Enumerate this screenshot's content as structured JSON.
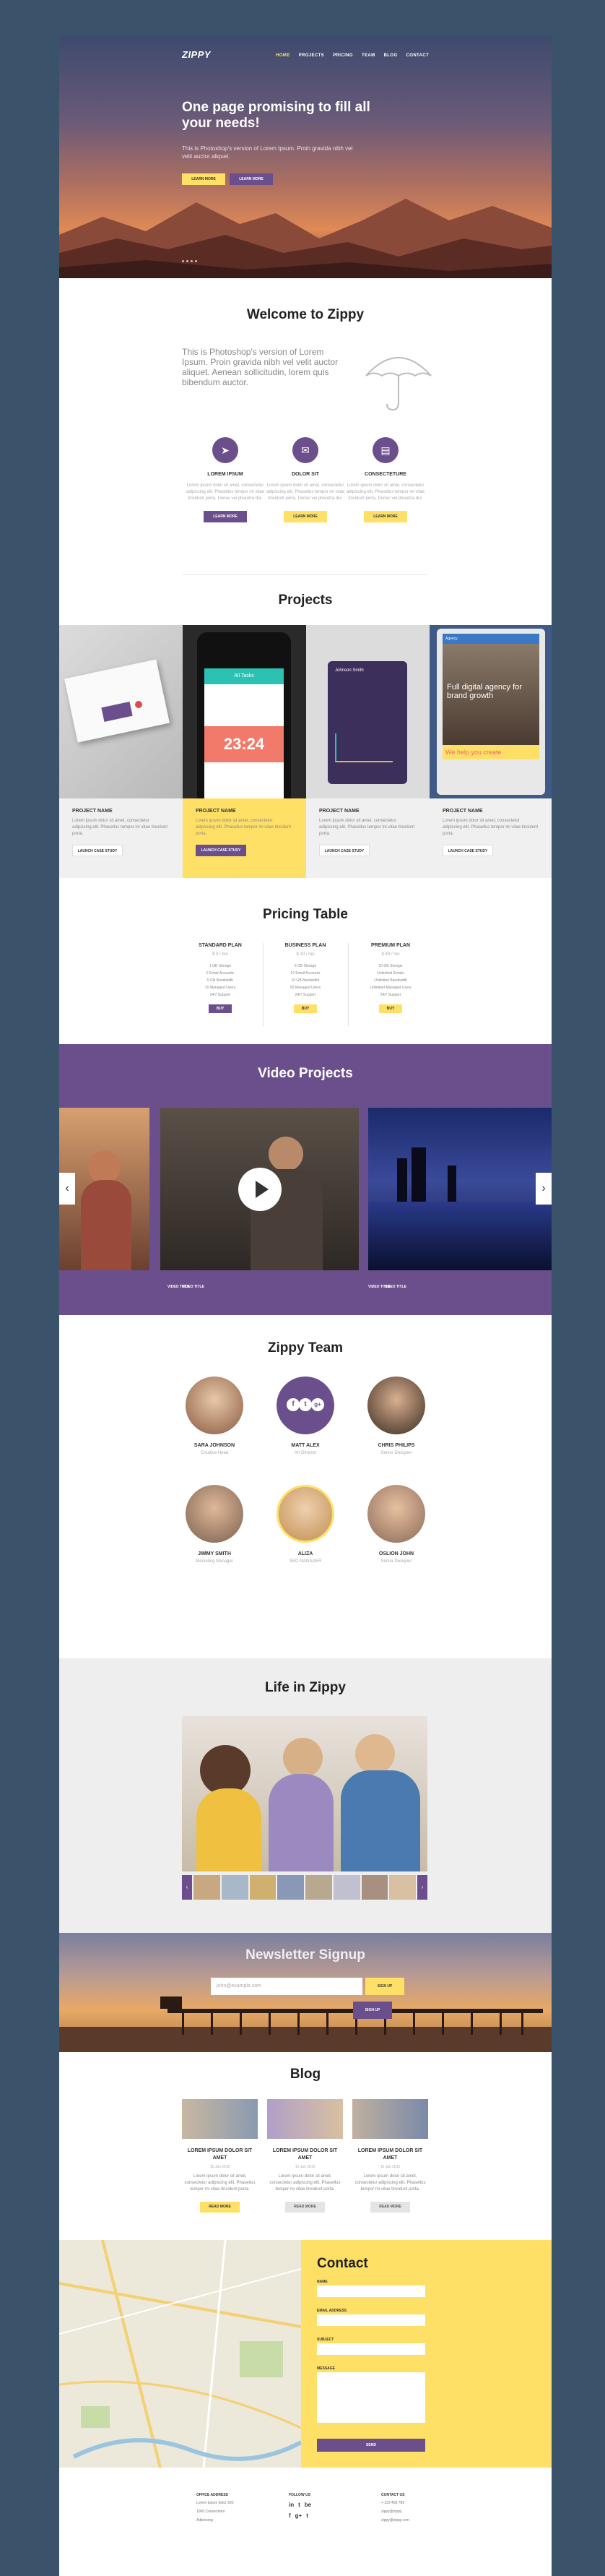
{
  "header": {
    "logo": "ZIPPY",
    "nav": [
      "HOME",
      "PROJECTS",
      "PRICING",
      "TEAM",
      "BLOG",
      "CONTACT"
    ]
  },
  "hero": {
    "title": "One page promising to fill all your needs!",
    "subtitle": "This is Photoshop's version of Lorem Ipsum. Proin gravida nibh vel velit auctor aliquet.",
    "primary_button": "LEARN MORE",
    "secondary_button": "LEARN MORE"
  },
  "welcome": {
    "title": "Welcome to Zippy",
    "text": "This is Photoshop's version of Lorem Ipsum. Proin gravida nibh vel velit auctor aliquet. Aenean sollicitudin, lorem quis bibendum auctor.",
    "features": [
      {
        "icon": "paper-plane-icon",
        "glyph": "➤",
        "title": "LOREM IPSUM",
        "text": "Lorem ipsum dolor sit amet, consectetur adipiscing elit. Phasellus tempor mi vitae tincidunt porta. Donec vel pharetra dui.",
        "button": "LEARN MORE"
      },
      {
        "icon": "mail-icon",
        "glyph": "✉",
        "title": "DOLOR SIT",
        "text": "Lorem ipsum dolor sit amet, consectetur adipiscing elit. Phasellus tempor mi vitae tincidunt porta. Donec vel pharetra dui.",
        "button": "LEARN MORE"
      },
      {
        "icon": "document-icon",
        "glyph": "▤",
        "title": "CONSECTETURE",
        "text": "Lorem ipsum dolor sit amet, consectetur adipiscing elit. Phasellus tempor mi vitae tincidunt porta. Donec vel pharetra dui.",
        "button": "LEARN MORE"
      }
    ]
  },
  "projects": {
    "title": "Projects",
    "items": [
      {
        "title": "PROJECT NAME",
        "text": "Lorem ipsum dolor sit amet, consectetur adipiscing elit. Phasellus tempor mi vitae tincidunt porta.",
        "button": "LAUNCH CASE STUDY"
      },
      {
        "title": "PROJECT NAME",
        "text": "Lorem ipsum dolor sit amet, consectetur adipiscing elit. Phasellus tempor mi vitae tincidunt porta.",
        "button": "LAUNCH CASE STUDY"
      },
      {
        "title": "PROJECT NAME",
        "text": "Lorem ipsum dolor sit amet, consectetur adipiscing elit. Phasellus tempor mi vitae tincidunt porta.",
        "button": "LAUNCH CASE STUDY"
      },
      {
        "title": "PROJECT NAME",
        "text": "Lorem ipsum dolor sit amet, consectetur adipiscing elit. Phasellus tempor mi vitae tincidunt porta.",
        "button": "LAUNCH CASE STUDY"
      }
    ],
    "phone_time": "23:24",
    "phone_label": "All Tasks",
    "tablet_brand": "Agency",
    "tablet_headline": "Full digital agency for brand growth",
    "tablet_footer": "We help you create",
    "laptop_name": "Johnson Smith"
  },
  "pricing": {
    "title": "Pricing Table",
    "plans": [
      {
        "name": "STANDARD PLAN",
        "price": "$ 9 / mo",
        "features": [
          "1 GB Storage",
          "5 Email Accounts",
          "5 GB Bandwidth",
          "10 Managed Users",
          "24/7 Support"
        ],
        "button": "BUY"
      },
      {
        "name": "BUSINESS PLAN",
        "price": "$ 19 / mo",
        "features": [
          "5 GB Storage",
          "10 Email Accounts",
          "10 GB Bandwidth",
          "50 Managed Users",
          "24/7 Support"
        ],
        "button": "BUY"
      },
      {
        "name": "PREMIUM PLAN",
        "price": "$ 49 / mo",
        "features": [
          "20 GB Storage",
          "Unlimited Emails",
          "Unlimited Bandwidth",
          "Unlimited Managed Users",
          "24/7 Support"
        ],
        "button": "BUY"
      }
    ]
  },
  "video": {
    "title": "Video Projects",
    "items": [
      "VIDEO TITLE",
      "VIDEO TITLE",
      "VIDEO TITLE",
      "VIDEO TITLE"
    ]
  },
  "team": {
    "title": "Zippy Team",
    "members": [
      {
        "name": "SARA JOHNSON",
        "role": "Creative Head"
      },
      {
        "name": "MATT ALEX",
        "role": "Art Director"
      },
      {
        "name": "CHRIS PHILIPS",
        "role": "Senior Designer"
      },
      {
        "name": "JIMMY SMITH",
        "role": "Marketing Manager"
      },
      {
        "name": "ALIZA",
        "role": "SEO MANAGER"
      },
      {
        "name": "OSLION JOHN",
        "role": "Senior Designer"
      }
    ],
    "social": [
      "f",
      "t",
      "g+"
    ]
  },
  "life": {
    "title": "Life in Zippy"
  },
  "newsletter": {
    "title": "Newsletter Signup",
    "placeholder": "john@example.com",
    "button": "SIGN UP",
    "button2": "SIGN UP"
  },
  "blog": {
    "title": "Blog",
    "posts": [
      {
        "title": "LOREM IPSUM DOLOR SIT AMET",
        "date": "15 Jan 2015",
        "text": "Lorem ipsum dolor sit amet, consectetur adipiscing elit. Phasellus tempor mi vitae tincidunt porta.",
        "button": "READ MORE"
      },
      {
        "title": "LOREM IPSUM DOLOR SIT AMET",
        "date": "15 Jan 2015",
        "text": "Lorem ipsum dolor sit amet, consectetur adipiscing elit. Phasellus tempor mi vitae tincidunt porta.",
        "button": "READ MORE"
      },
      {
        "title": "LOREM IPSUM DOLOR SIT AMET",
        "date": "15 Jan 2015",
        "text": "Lorem ipsum dolor sit amet, consectetur adipiscing elit. Phasellus tempor mi vitae tincidunt porta.",
        "button": "READ MORE"
      }
    ]
  },
  "contact": {
    "title": "Contact",
    "fields": [
      "NAME",
      "EMAIL ADDRESS",
      "SUBJECT",
      "MESSAGE"
    ],
    "button": "SEND"
  },
  "footer": {
    "office": {
      "title": "OFFICE ADDRESS",
      "lines": [
        "Lorem Ipsum dolor 250",
        "1000 Consectetur",
        "Adipiscing"
      ]
    },
    "follow": {
      "title": "FOLLOW US",
      "icons": [
        "in",
        "t",
        "be",
        "f",
        "g+",
        "t"
      ]
    },
    "contact": {
      "title": "CONTACT US",
      "lines": [
        "+ 123 456 789",
        "zippy@zippy",
        "zippy@zippy.com"
      ]
    }
  },
  "colors": {
    "accent_purple": "#6b4f8c",
    "accent_yellow": "#ffe066",
    "background": "#3a536b"
  }
}
